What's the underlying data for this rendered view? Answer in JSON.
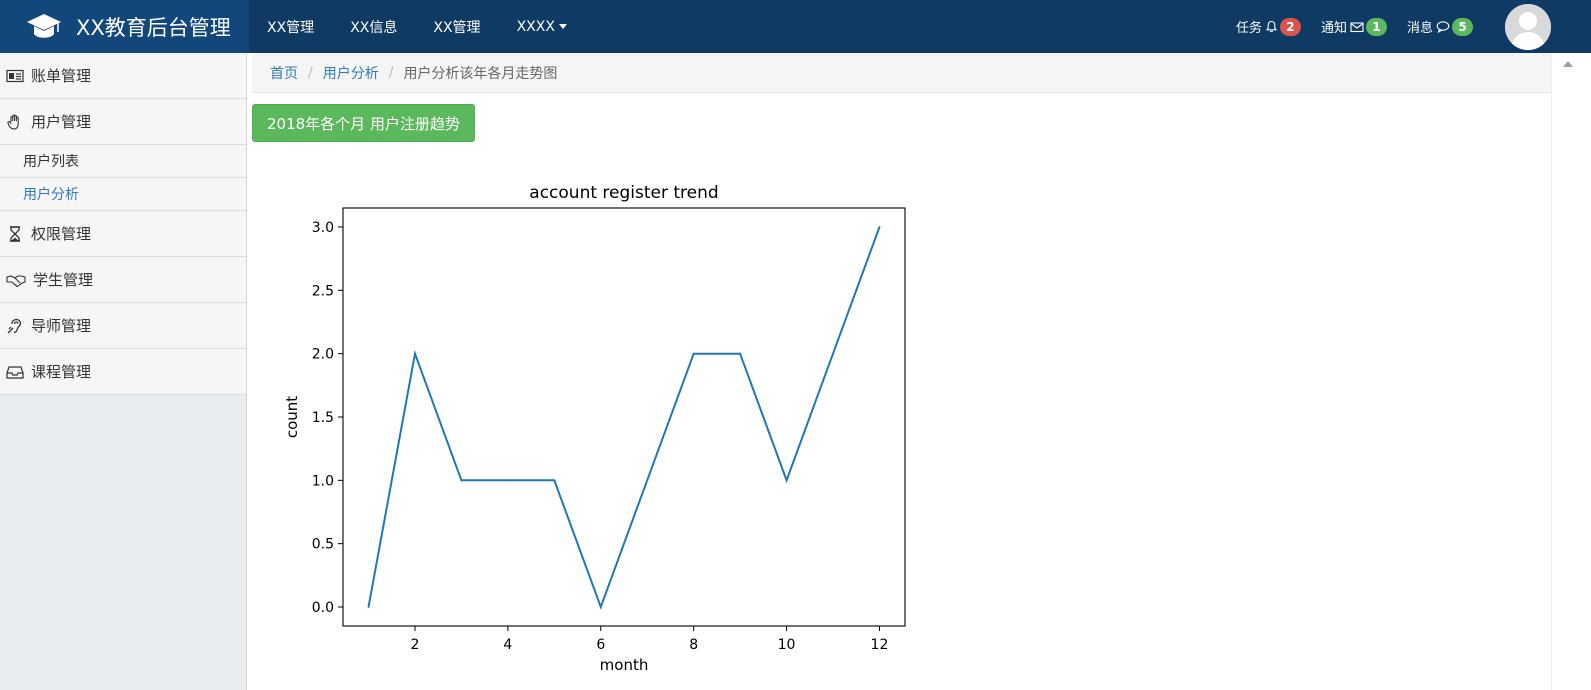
{
  "app": {
    "title": "XX教育后台管理"
  },
  "topnav": {
    "items": [
      "XX管理",
      "XX信息",
      "XX管理"
    ],
    "dropdown": "XXXX"
  },
  "topright": {
    "tasks": {
      "label": "任务",
      "count": "2",
      "color": "#d9534f"
    },
    "notices": {
      "label": "通知",
      "count": "1",
      "color": "#5cb85c"
    },
    "messages": {
      "label": "消息",
      "count": "5",
      "color": "#5cb85c"
    }
  },
  "sidebar": {
    "items": [
      {
        "label": "账单管理",
        "icon": "id-card-icon"
      },
      {
        "label": "用户管理",
        "icon": "hand-icon"
      },
      {
        "label": "权限管理",
        "icon": "hourglass-icon"
      },
      {
        "label": "学生管理",
        "icon": "handshake-icon"
      },
      {
        "label": "导师管理",
        "icon": "hearing-icon"
      },
      {
        "label": "课程管理",
        "icon": "inbox-icon"
      }
    ],
    "subitems": [
      {
        "label": "用户列表",
        "active": false
      },
      {
        "label": "用户分析",
        "active": true
      }
    ]
  },
  "breadcrumb": {
    "home": "首页",
    "parent": "用户分析",
    "current": "用户分析该年各月走势图"
  },
  "main": {
    "title_button": "2018年各个月  用户注册趋势"
  },
  "colors": {
    "topbar": "#0f3a63",
    "brand": "#11477a",
    "line": "#1f77b4",
    "button": "#5cb85c",
    "link": "#337ab7"
  },
  "chart_data": {
    "type": "line",
    "title": "account register trend",
    "xlabel": "month",
    "ylabel": "count",
    "x": [
      1,
      2,
      3,
      4,
      5,
      6,
      7,
      8,
      9,
      10,
      11,
      12
    ],
    "series": [
      {
        "values": [
          0,
          2,
          1,
          1,
          1,
          0,
          1,
          2,
          2,
          1,
          2,
          3
        ]
      }
    ],
    "xticks": [
      2,
      4,
      6,
      8,
      10,
      12
    ],
    "yticks": [
      "0.0",
      "0.5",
      "1.0",
      "1.5",
      "2.0",
      "2.5",
      "3.0"
    ],
    "xlim": [
      0.45,
      12.55
    ],
    "ylim": [
      -0.15,
      3.15
    ],
    "grid": false
  }
}
